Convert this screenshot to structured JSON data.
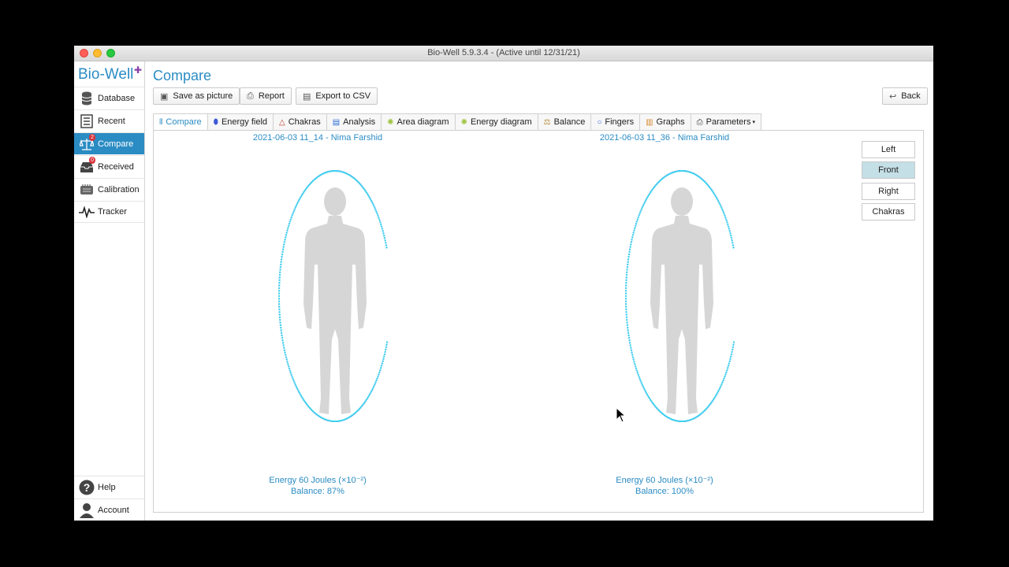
{
  "window": {
    "title": "Bio-Well 5.9.3.4 -  (Active until 12/31/21)"
  },
  "logo": {
    "text": "Bio-Well"
  },
  "sidebar": {
    "items": [
      {
        "label": "Database",
        "icon": "database-icon"
      },
      {
        "label": "Recent",
        "icon": "list-icon"
      },
      {
        "label": "Compare",
        "icon": "scales-icon",
        "badge": "2",
        "active": true
      },
      {
        "label": "Received",
        "icon": "inbox-icon",
        "badge": "0"
      },
      {
        "label": "Calibration",
        "icon": "calibration-icon"
      },
      {
        "label": "Tracker",
        "icon": "pulse-icon"
      }
    ],
    "bottom": [
      {
        "label": "Help",
        "icon": "help-icon"
      },
      {
        "label": "Account",
        "icon": "user-icon"
      }
    ]
  },
  "page": {
    "title": "Compare"
  },
  "toolbar": {
    "save_picture": "Save as picture",
    "report": "Report",
    "export_csv": "Export to CSV",
    "back": "Back"
  },
  "tabs": [
    {
      "label": "Compare",
      "active": true
    },
    {
      "label": "Energy field"
    },
    {
      "label": "Chakras"
    },
    {
      "label": "Analysis"
    },
    {
      "label": "Area diagram"
    },
    {
      "label": "Energy diagram"
    },
    {
      "label": "Balance"
    },
    {
      "label": "Fingers"
    },
    {
      "label": "Graphs"
    },
    {
      "label": "Parameters"
    }
  ],
  "panels": [
    {
      "caption": "2021-06-03 11_14 - Nima Farshid",
      "energy": "Energy 60 Joules (×10⁻²)",
      "balance": "Balance: 87%"
    },
    {
      "caption": "2021-06-03 11_36 - Nima Farshid",
      "energy": "Energy 60 Joules (×10⁻²)",
      "balance": "Balance: 100%"
    }
  ],
  "views": {
    "left": "Left",
    "front": "Front",
    "right": "Right",
    "chakras": "Chakras",
    "selected": "Front"
  },
  "colors": {
    "accent": "#2b8cc4",
    "aura_inner": "#3fd2f0",
    "aura_mid": "#6b3fd6",
    "aura_outer": "#e0609a",
    "silhouette": "#d6d6d6"
  }
}
